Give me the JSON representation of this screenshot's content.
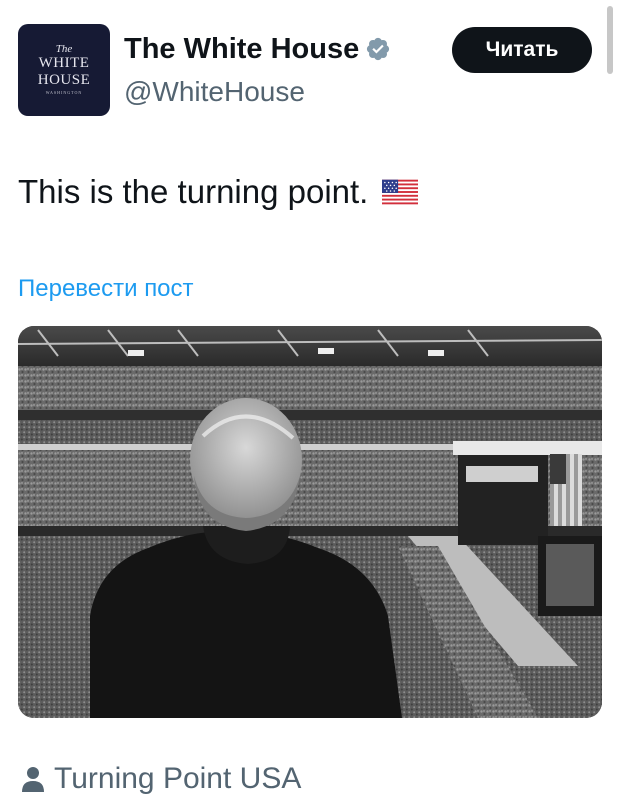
{
  "account": {
    "name": "The White House",
    "handle": "@WhiteHouse",
    "avatar_text": {
      "the": "The",
      "white": "WHITE",
      "house": "HOUSE",
      "washington": "WASHINGTON"
    },
    "verified_icon": "verified-badge-icon",
    "verified_color": "#829aab"
  },
  "follow_button": {
    "label": "Читать"
  },
  "tweet": {
    "text": "This is the turning point.",
    "emoji": "us-flag-icon",
    "translate_label": "Перевести пост"
  },
  "media": {
    "description_icon": "stadium-photo"
  },
  "footer": {
    "icon": "person-icon",
    "label": "Turning Point USA"
  },
  "colors": {
    "text": "#0f1419",
    "secondary": "#536471",
    "link": "#1d9bf0",
    "button_bg": "#0f1419",
    "avatar_bg": "#161a34"
  }
}
